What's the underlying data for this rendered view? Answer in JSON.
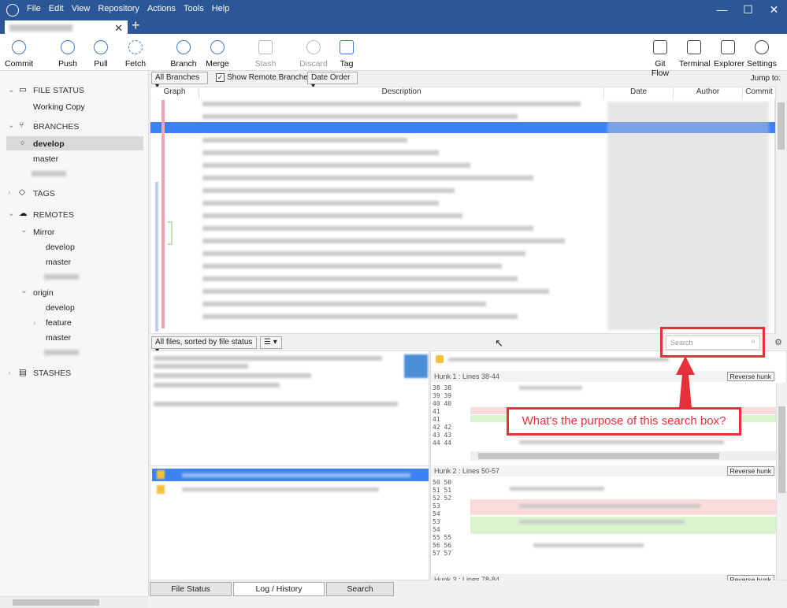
{
  "menu": [
    "File",
    "Edit",
    "View",
    "Repository",
    "Actions",
    "Tools",
    "Help"
  ],
  "window_controls": {
    "minimize": "—",
    "maximize": "☐",
    "close": "✕"
  },
  "tab": {
    "close": "✕",
    "new": "+"
  },
  "toolbar": {
    "commit": "Commit",
    "push": "Push",
    "pull": "Pull",
    "fetch": "Fetch",
    "branch": "Branch",
    "merge": "Merge",
    "stash": "Stash",
    "discard": "Discard",
    "tag": "Tag",
    "gitflow": "Git Flow",
    "terminal": "Terminal",
    "explorer": "Explorer",
    "settings": "Settings"
  },
  "sidebar": {
    "file_status": "FILE STATUS",
    "working_copy": "Working Copy",
    "branches": "BRANCHES",
    "develop": "develop",
    "master": "master",
    "tags": "TAGS",
    "remotes": "REMOTES",
    "mirror": "Mirror",
    "mirror_develop": "develop",
    "mirror_master": "master",
    "origin": "origin",
    "origin_develop": "develop",
    "origin_feature": "feature",
    "origin_master": "master",
    "stashes": "STASHES"
  },
  "filters": {
    "branches": "All Branches",
    "show_remote": "Show Remote Branches",
    "order": "Date Order",
    "jump_to": "Jump to:"
  },
  "columns": {
    "graph": "Graph",
    "description": "Description",
    "date": "Date",
    "author": "Author",
    "commit": "Commit"
  },
  "mid": {
    "files_sort": "All files, sorted by file status",
    "view_mode": "☰",
    "search_placeholder": "Search"
  },
  "hunks": [
    {
      "title": "Hunk 1 : Lines 38-44",
      "button": "Reverse hunk"
    },
    {
      "title": "Hunk 2 : Lines 50-57",
      "button": "Reverse hunk"
    },
    {
      "title": "Hunk 3 : Lines 78-84",
      "button": "Reverse hunk"
    }
  ],
  "hunk1_lines": [
    "38  38",
    "39  39",
    "40  40",
    "41",
    "    41",
    "42  42",
    "43  43",
    "44  44"
  ],
  "hunk2_lines": [
    "50  50",
    "51  51",
    "52  52",
    "53",
    "54",
    "    53",
    "    54",
    "55  55",
    "56  56",
    "57  57"
  ],
  "annotation": "What's the purpose of this search box?",
  "bottom_tabs": [
    "File Status",
    "Log / History",
    "Search"
  ],
  "accent_color": "#2b5797",
  "annotation_color": "#e8303b"
}
